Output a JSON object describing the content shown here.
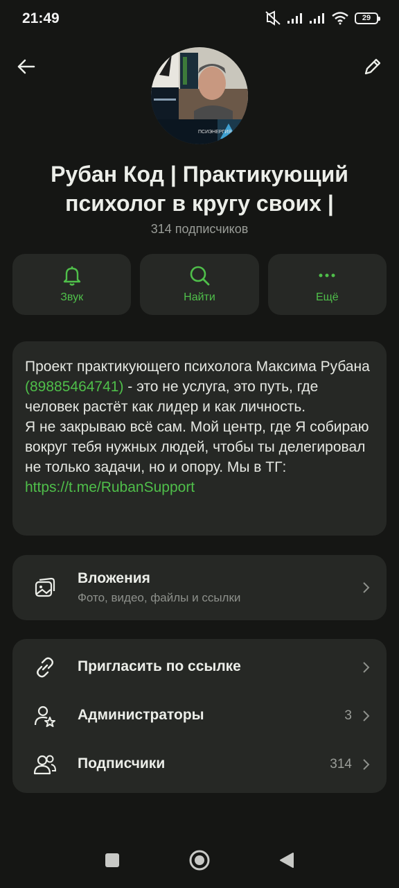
{
  "status": {
    "time": "21:49",
    "battery": "29"
  },
  "channel": {
    "title": "Рубан Код | Практикующий психолог в кругу своих |",
    "subscribers_label": "314 подписчиков"
  },
  "actions": [
    {
      "label": "Звук",
      "icon": "bell-icon"
    },
    {
      "label": "Найти",
      "icon": "search-icon"
    },
    {
      "label": "Ещё",
      "icon": "more-icon"
    }
  ],
  "description": {
    "part1": "Проект практикующего психолога Максима Рубана ",
    "phone": "(89885464741)",
    "part2": " -  это не услуга, это путь, где человек растёт как лидер и как личность.",
    "part3": "Я не закрываю всё сам. Мой центр, где Я собираю вокруг тебя нужных людей, чтобы ты делегировал не только задачи, но и опору. Мы в ТГ: ",
    "url": "https://t.me/RubanSupport"
  },
  "attachments": {
    "title": "Вложения",
    "subtitle": "Фото, видео, файлы и ссылки"
  },
  "list": [
    {
      "label": "Пригласить по ссылке",
      "count": ""
    },
    {
      "label": "Администраторы",
      "count": "3"
    },
    {
      "label": "Подписчики",
      "count": "314"
    }
  ],
  "avatar_logo_text": "ПСИЭНЕРГИЯ",
  "colors": {
    "accent": "#4fbf4a",
    "background": "#151614",
    "card": "#262825"
  }
}
